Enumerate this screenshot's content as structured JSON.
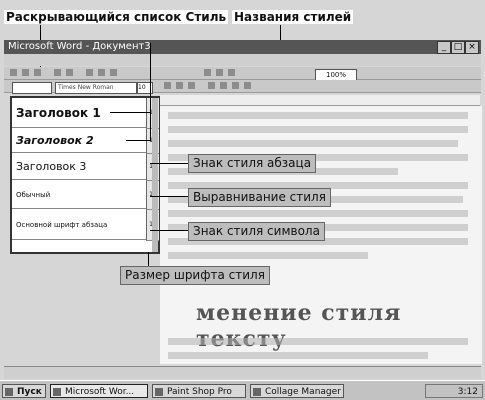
{
  "callouts": {
    "style_dropdown": "Раскрывающийся список Стиль",
    "style_names": "Названия стилей",
    "paragraph_style_mark": "Знак стиля абзаца",
    "alignment": "Выравнивание стиля",
    "character_style_mark": "Знак стиля символа",
    "font_size": "Размер шрифта стиля"
  },
  "window": {
    "title": "Microsoft Word - Документ3"
  },
  "toolbar": {
    "font_name": "Times New Roman",
    "font_size": "10",
    "zoom": "100%"
  },
  "style_list": {
    "items": [
      {
        "label": "Заголовок 1",
        "size": "14"
      },
      {
        "label": "Заголовок 2",
        "size": "12"
      },
      {
        "label": "Заголовок 3",
        "size": "12"
      },
      {
        "label": "Обычный",
        "size": "10"
      },
      {
        "label": "Основной шрифт абзаца",
        "size": "10"
      }
    ]
  },
  "document": {
    "heading_fragment": "менение стиля тексту"
  },
  "taskbar": {
    "start": "Пуск",
    "tasks": [
      "Microsoft Wor...",
      "Paint Shop Pro",
      "Collage Manager"
    ],
    "clock": "3:12"
  }
}
